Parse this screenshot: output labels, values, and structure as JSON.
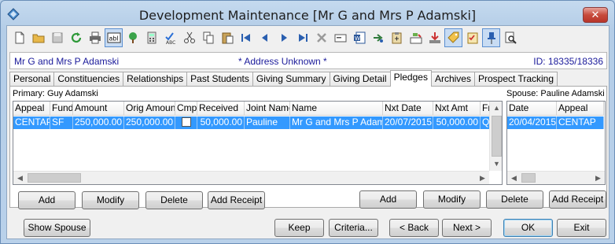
{
  "window": {
    "title": "Development Maintenance  [Mr G and Mrs P Adamski]",
    "close_glyph": "✕"
  },
  "toolbar": {
    "icons": [
      "new-document-icon",
      "open-folder-icon",
      "save-disk-icon",
      "refresh-icon",
      "print-icon",
      "abl-icon",
      "tree-icon",
      "calculator-icon",
      "spellcheck-icon",
      "cut-icon",
      "copy-icon",
      "paste-icon",
      "first-record-icon",
      "previous-record-icon",
      "next-record-icon",
      "last-record-icon",
      "delete-icon",
      "card-icon",
      "word-icon",
      "arrow-export-icon",
      "clipboard-add-icon",
      "mail-merge-icon",
      "download-tray-icon",
      "tag-icon",
      "checklist-icon",
      "pin-icon",
      "preview-icon"
    ],
    "abl_text": "abl"
  },
  "client_bar": {
    "name": "Mr G and Mrs P Adamski",
    "address_status": "* Address Unknown *",
    "id": "ID: 18335/18336"
  },
  "tabs": [
    "Personal",
    "Constituencies",
    "Relationships",
    "Past Students",
    "Giving Summary",
    "Giving Detail",
    "Pledges",
    "Archives",
    "Prospect Tracking"
  ],
  "selected_tab": "Pledges",
  "primary": {
    "label": "Primary: Guy Adamski",
    "columns": [
      "Appeal",
      "Fund",
      "Amount",
      "Orig Amount",
      "Cmp",
      "Received",
      "Joint Name",
      "Name",
      "Nxt Date",
      "Nxt Amt",
      "Fr"
    ],
    "rows": [
      {
        "appeal": "CENTAP",
        "fund": "SF",
        "amount": "250,000.00",
        "orig_amount": "250,000.00",
        "cmp": "",
        "received": "50,000.00",
        "joint_name": "Pauline",
        "name": "Mr G and Mrs P Adamski",
        "nxt_date": "20/07/2015",
        "nxt_amt": "50,000.00",
        "fr": "Q"
      }
    ],
    "buttons": {
      "add": "Add",
      "modify": "Modify",
      "delete": "Delete",
      "add_receipt": "Add Receipt"
    }
  },
  "spouse": {
    "label": "Spouse: Pauline Adamski",
    "columns": [
      "Date",
      "Appeal"
    ],
    "rows": [
      {
        "date": "20/04/2015",
        "appeal": "CENTAP"
      }
    ],
    "buttons": {
      "add": "Add",
      "modify": "Modify",
      "delete": "Delete",
      "add_receipt": "Add Receipt"
    }
  },
  "footer": {
    "show_spouse": "Show Spouse",
    "keep": "Keep",
    "criteria": "Criteria...",
    "back": "< Back",
    "next": "Next >",
    "ok": "OK",
    "exit": "Exit"
  },
  "colors": {
    "selection": "#3399ff",
    "client_text": "#1a1a9a"
  }
}
